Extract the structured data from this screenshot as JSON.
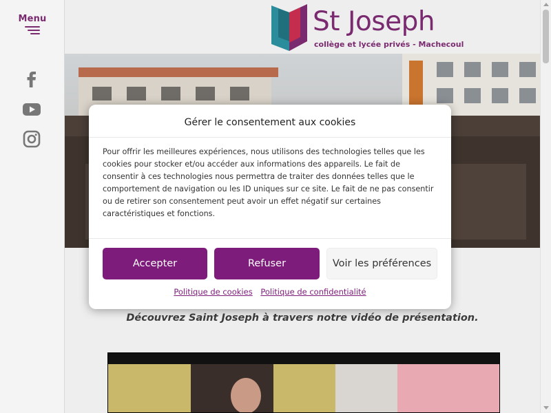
{
  "sidebar": {
    "menu_label": "Menu",
    "social": [
      {
        "icon": "facebook-icon"
      },
      {
        "icon": "youtube-icon"
      },
      {
        "icon": "instagram-icon"
      }
    ]
  },
  "header": {
    "logo_name": "St Joseph",
    "logo_subtitle": "collège et lycée privés - Machecoul"
  },
  "page": {
    "intro_text": "Découvrez Saint Joseph à travers notre vidéo de présentation."
  },
  "cookie_modal": {
    "title": "Gérer le consentement aux cookies",
    "body": "Pour offrir les meilleures expériences, nous utilisons des technologies telles que les\ncookies pour stocker et/ou accéder aux informations des appareils. Le fait de\nconsentir à ces technologies nous permettra de traiter des données telles que le\ncomportement de navigation ou les ID uniques sur ce site. Le fait de ne pas consentir\nou de retirer son consentement peut avoir un effet négatif sur certaines\ncaractéristiques et fonctions.",
    "accept_label": "Accepter",
    "refuse_label": "Refuser",
    "preferences_label": "Voir les préférences",
    "links": [
      "Politique de cookies",
      "Politique de confidentialité"
    ]
  },
  "colors": {
    "brand_purple": "#7a2a6f",
    "button_purple": "#7d1c7b",
    "logo_teal": "#2b8c9c",
    "logo_red": "#c42d4d"
  }
}
